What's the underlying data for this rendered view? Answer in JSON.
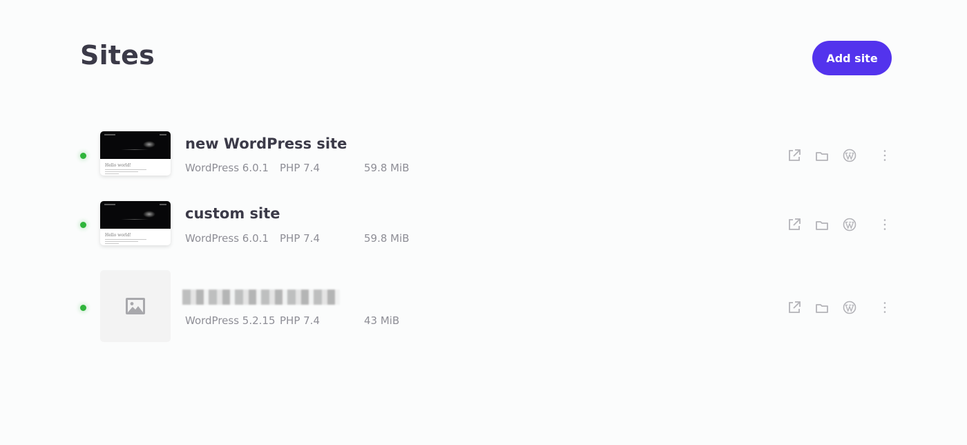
{
  "header": {
    "title": "Sites",
    "add_site_label": "Add site"
  },
  "colors": {
    "accent": "#5333ed",
    "status_running": "#2fb53b",
    "text_primary": "#3b3a48",
    "text_secondary": "#8e8e96"
  },
  "sites": [
    {
      "name": "new WordPress site",
      "status": "running",
      "thumbnail": "site-preview",
      "thumbnail_heading": "Hello world!",
      "wordpress_version": "WordPress 6.0.1",
      "php_version": "PHP 7.4",
      "size": "59.8 MiB",
      "actions": [
        "external-link-icon",
        "folder-icon",
        "wordpress-icon",
        "more-icon"
      ]
    },
    {
      "name": "custom site",
      "status": "running",
      "thumbnail": "site-preview",
      "thumbnail_heading": "Hello world!",
      "wordpress_version": "WordPress 6.0.1",
      "php_version": "PHP 7.4",
      "size": "59.8 MiB",
      "actions": [
        "external-link-icon",
        "folder-icon",
        "wordpress-icon",
        "more-icon"
      ]
    },
    {
      "name": "",
      "name_obscured": true,
      "status": "running",
      "thumbnail": "image-placeholder-icon",
      "wordpress_version": "WordPress 5.2.15",
      "php_version": "PHP 7.4",
      "size": "43 MiB",
      "actions": [
        "external-link-icon",
        "folder-icon",
        "wordpress-icon",
        "more-icon"
      ]
    }
  ]
}
